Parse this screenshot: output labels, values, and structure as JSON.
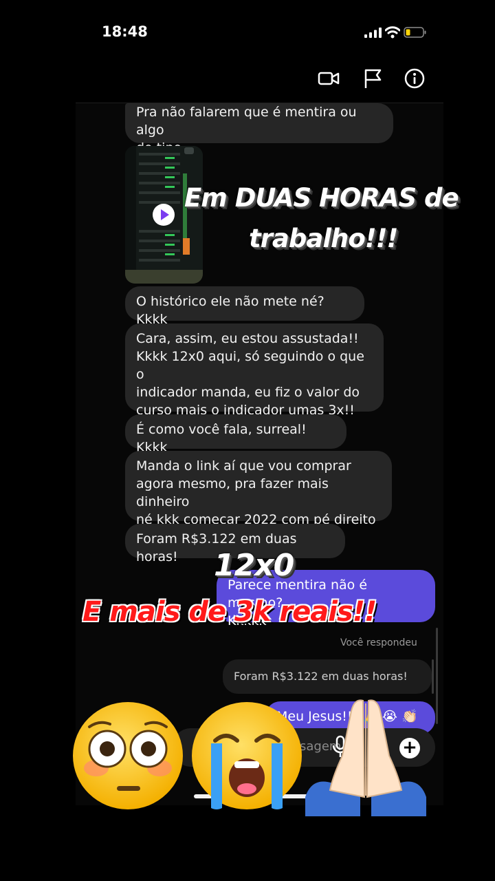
{
  "status_bar": {
    "time": "18:48"
  },
  "messages": {
    "m1": "Pra não falarem que é mentira ou algo\ndo tipo",
    "m2": "O histórico ele não mete né? Kkkk",
    "m3": "Cara, assim, eu estou assustada!!\nKkkk 12x0 aqui, só seguindo o que o\nindicador manda, eu fiz o valor do\ncurso mais o indicador umas 3x!!",
    "m4": "É como você fala, surreal! Kkkk",
    "m5": "Manda o link aí que vou comprar\nagora mesmo, pra fazer mais dinheiro\nné kkk começar 2022 com pé direito",
    "m6": "Foram R$3.122 em duas horas!",
    "out1": "Parece mentira não é mesmo?\nKkkkk",
    "reply_caption": "Você respondeu",
    "quoted": "Foram R$3.122 em duas horas!",
    "out2": "Meu Jesus!!! 🙏 😭 👏🏻"
  },
  "composer": {
    "placeholder": "Mensagem..."
  },
  "overlays": {
    "headline_line1": "Em DUAS HORAS de",
    "headline_line2": "trabalho!!!",
    "score": "12x0",
    "reais": "E mais de 3k reais!!"
  },
  "colors": {
    "incoming_bubble": "#262626",
    "outgoing_bubble": "#5b4bdb",
    "overlay_red": "#ff1a1a"
  },
  "icons": [
    "video-call-icon",
    "flag-icon",
    "info-icon",
    "microphone-icon",
    "plus-icon",
    "play-icon",
    "flushed-face-emoji",
    "loudly-crying-face-emoji",
    "folded-hands-emoji"
  ]
}
